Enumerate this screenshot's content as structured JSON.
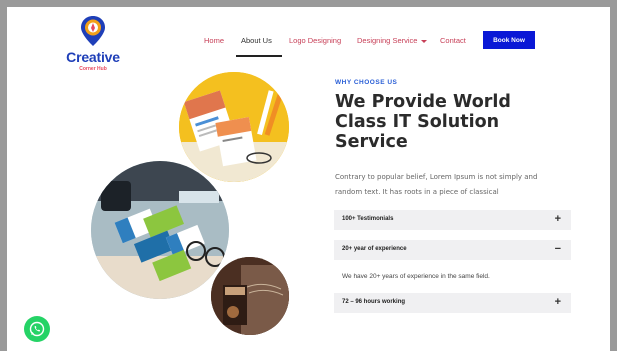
{
  "logo": {
    "name": "Creative",
    "sub": "Corner Hub"
  },
  "nav": {
    "items": [
      "Home",
      "About Us",
      "Logo Designing",
      "Designing Service",
      "Contact"
    ],
    "active": "About Us"
  },
  "header": {
    "cta": "Book Now"
  },
  "content": {
    "eyebrow": "WHY CHOOSE US",
    "title_lines": [
      "We Provide World",
      "Class IT Solution",
      "Service"
    ],
    "paragraph_lines": [
      "Contrary to popular belief, Lorem Ipsum is not simply and",
      "random text. It has roots in a piece of classical"
    ]
  },
  "accordion": [
    {
      "title": "100+ Testimonials",
      "sign": "+",
      "expanded": false
    },
    {
      "title": "20+ year of experience",
      "sign": "−",
      "expanded": true,
      "body": "We have 20+ years of experience in the same field."
    },
    {
      "title": "72 – 96 hours working",
      "sign": "+",
      "expanded": false
    }
  ],
  "colors": {
    "brand_blue": "#1f3fb8",
    "cta_blue": "#0a18d6",
    "nav_text": "#c73f57",
    "accent_blue": "#2a5fd6",
    "whatsapp": "#25d366"
  },
  "icons": {
    "logo": "location-pin-logo-icon",
    "whatsapp": "whatsapp-icon"
  }
}
